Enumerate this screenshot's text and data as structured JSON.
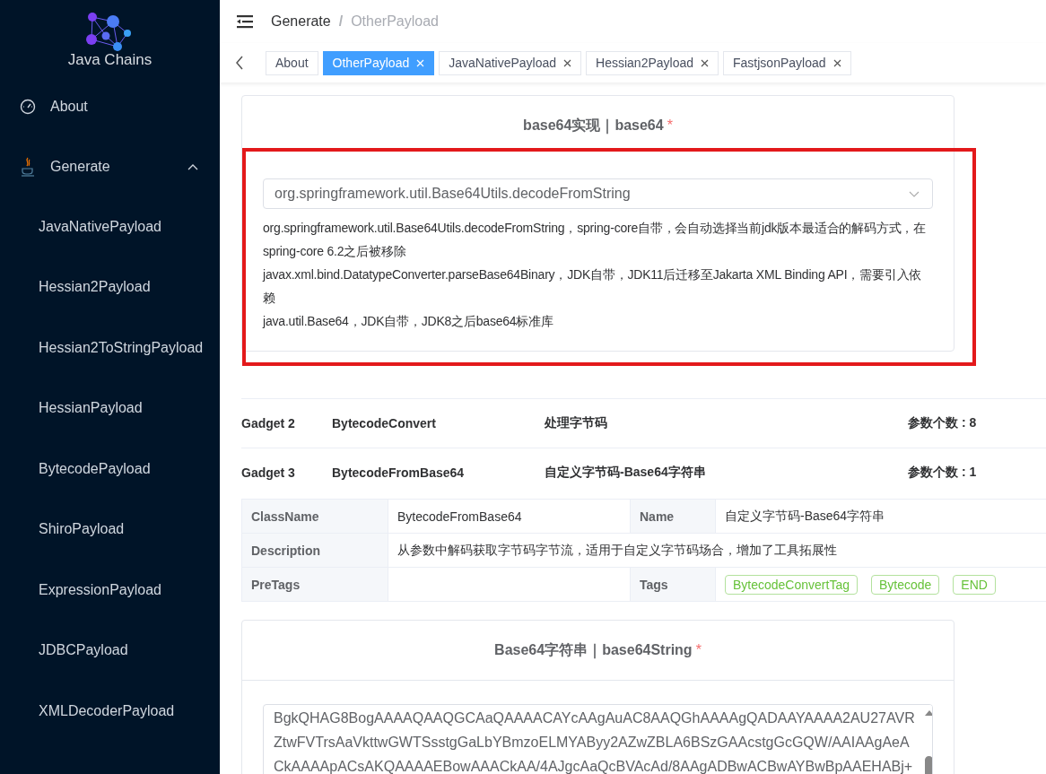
{
  "sidebar": {
    "logo_text": "Java Chains",
    "items": [
      {
        "kind": "link",
        "label": "About",
        "selected": false
      },
      {
        "kind": "group",
        "label": "Generate",
        "expanded": true,
        "children": [
          {
            "label": "JavaNativePayload",
            "selected": false
          },
          {
            "label": "Hessian2Payload",
            "selected": false
          },
          {
            "label": "Hessian2ToStringPayload",
            "selected": false
          },
          {
            "label": "HessianPayload",
            "selected": false
          },
          {
            "label": "BytecodePayload",
            "selected": false
          },
          {
            "label": "ShiroPayload",
            "selected": false
          },
          {
            "label": "ExpressionPayload",
            "selected": false
          },
          {
            "label": "JDBCPayload",
            "selected": false
          },
          {
            "label": "XMLDecoderPayload",
            "selected": false
          }
        ]
      }
    ]
  },
  "breadcrumb": {
    "separator": "/",
    "items": [
      "Generate",
      "OtherPayload"
    ]
  },
  "tabs": [
    {
      "label": "About",
      "selected": false,
      "closable": false
    },
    {
      "label": "OtherPayload",
      "selected": true,
      "closable": true
    },
    {
      "label": "JavaNativePayload",
      "selected": false,
      "closable": true
    },
    {
      "label": "Hessian2Payload",
      "selected": false,
      "closable": true
    },
    {
      "label": "FastjsonPayload",
      "selected": false,
      "closable": true
    }
  ],
  "top_card": {
    "title": "base64实现｜base64",
    "required_mark": "*",
    "highlighted": true,
    "select": {
      "value": "org.springframework.util.Base64Utils.decodeFromString"
    },
    "help": [
      "org.springframework.util.Base64Utils.decodeFromString，spring-core自带，会自动选择当前jdk版本最适合的解码方式，在spring-core 6.2之后被移除",
      "javax.xml.bind.DatatypeConverter.parseBase64Binary，JDK自带，JDK11后迁移至Jakarta XML Binding API，需要引入依赖",
      "java.util.Base64，JDK自带，JDK8之后base64标准库"
    ]
  },
  "gadgets": [
    {
      "label": "Gadget 2",
      "name": "BytecodeConvert",
      "description": "处理字节码",
      "params": "参数个数 : 8"
    },
    {
      "label": "Gadget 3",
      "name": "BytecodeFromBase64",
      "description": "自定义字节码-Base64字符串",
      "params": "参数个数 : 1"
    }
  ],
  "details": [
    [
      {
        "label": "ClassName",
        "value": "BytecodeFromBase64"
      },
      {
        "label": "Name",
        "value": "自定义字节码-Base64字符串"
      }
    ],
    [
      {
        "label": "Description",
        "value": "从参数中解码获取字节码字节流，适用于自定义字节码场合，增加了工具拓展性"
      }
    ],
    [
      {
        "label": "PreTags"
      },
      {
        "label": "Tags",
        "tags": [
          "BytecodeConvertTag",
          "Bytecode",
          "END"
        ]
      }
    ]
  ],
  "string_card": {
    "title": "Base64字符串｜base64String",
    "required_mark": "*",
    "lines": [
      "BgkQHAG8BogAAAAQAAQGCAaQAAAACAYcAAgAuAC8AAQGhAAAAgQADAAYAAAA2AU27AVR",
      "ZtwFVTrsAaVkttwGWTSsstgGaLbYBmzoELMYAByy2AZwZBLA6BSzGAAcstgGcGQW/AAIAAgAeA",
      "CkAAAApACsAKQAAAAEBowAAACkAA/4AJgcAaQcBVAcAd/8AAgADBwACBwAYBwBpAAEHABj+"
    ]
  }
}
